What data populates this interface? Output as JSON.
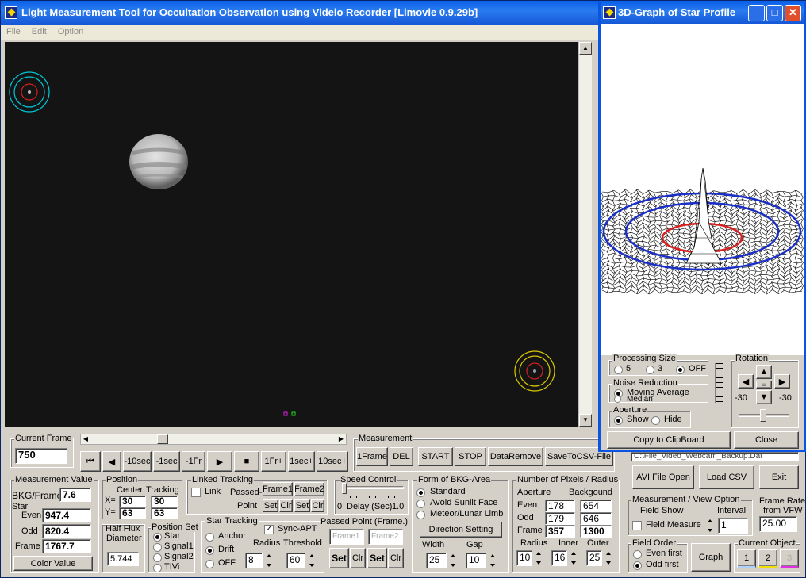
{
  "app": {
    "title": "Light Measurement Tool for Occultation Observation using Videio Recorder [Limovie 0.9.29b]",
    "menu": [
      "File",
      "Edit",
      "Option"
    ]
  },
  "colors": {
    "title_bar": "#0a5fe8",
    "video_bg": "#141414",
    "aperture_cyan": "#00c8d8",
    "aperture_yellow": "#d8c800",
    "aperture_red": "#d82020"
  },
  "current_frame": {
    "label": "Current Frame",
    "value": "750"
  },
  "transport": {
    "first": "⏮",
    "back": "◀",
    "minus10sec": "-10sec",
    "minus1sec": "-1sec",
    "minus1fr": "-1Fr",
    "play": "▶",
    "stop": "■",
    "plus1fr": "1Fr+",
    "plus1sec": "1sec+",
    "plus10sec": "10sec+"
  },
  "measurement": {
    "label": "Measurement",
    "oneframe": "1Frame",
    "del": "DEL",
    "start": "START",
    "stop": "STOP",
    "dataremove": "DataRemove",
    "savecsv": "SaveToCSV-File"
  },
  "file_path": "C:\\File_Video_Webcam_Backup.Dat",
  "measurement_value": {
    "label": "Measurement Value",
    "bkg_label": "BKG/Frame",
    "bkg": "7.6",
    "star_label": "Star",
    "even_label": "Even",
    "even": "947.4",
    "odd_label": "Odd",
    "odd": "820.4",
    "frame_label": "Frame",
    "frame": "1767.7",
    "color_button": "Color Value"
  },
  "position": {
    "label": "Position",
    "center": "Center",
    "tracking": "Tracking",
    "x_label": "X=",
    "y_label": "Y=",
    "cx": "30",
    "cy": "63",
    "tx": "30",
    "ty": "63"
  },
  "half_flux": {
    "label1": "Half Flux",
    "label2": "Diameter",
    "value": "5.744"
  },
  "position_set": {
    "label": "Position Set",
    "options": [
      "Star",
      "Signal1",
      "Signal2",
      "TIVi"
    ],
    "selected": 0
  },
  "linked_tracking": {
    "label": "Linked Tracking",
    "link": "Link",
    "passed1": "Passed-",
    "passed2": "Point",
    "frame1": "Frame1",
    "frame2": "Frame2",
    "set": "Set",
    "clr": "Clr"
  },
  "speed_control": {
    "label": "Speed Control",
    "min": "0",
    "delay": "Delay (Sec)",
    "max": "1.0",
    "level": 0.0
  },
  "star_tracking": {
    "label": "Star Tracking",
    "options": [
      "Anchor",
      "Drift",
      "OFF"
    ],
    "selected": 1,
    "sync": "Sync-APT",
    "radius_label": "Radius",
    "threshold_label": "Threshold",
    "radius": "8",
    "threshold": "60"
  },
  "passed_point": {
    "label": "Passed Point (Frame.)",
    "frame1": "Frame1",
    "frame2": "Frame2",
    "set": "Set",
    "clr": "Clr"
  },
  "bkg_area": {
    "label": "Form of BKG-Area",
    "options": [
      "Standard",
      "Avoid Sunlit Face",
      "Meteor/Lunar Limb"
    ],
    "selected": 0,
    "direction": "Direction Setting",
    "width_label": "Width",
    "gap_label": "Gap",
    "width": "25",
    "gap": "10"
  },
  "pixels": {
    "label": "Number of Pixels / Radius",
    "aperture": "Aperture",
    "background": "Backgound",
    "even_label": "Even",
    "odd_label": "Odd",
    "frame_label": "Frame",
    "ap_even": "178",
    "bg_even": "654",
    "ap_odd": "179",
    "bg_odd": "646",
    "ap_frame": "357",
    "bg_frame": "1300",
    "radius_label": "Radius",
    "inner_label": "Inner",
    "outer_label": "Outer",
    "radius": "10",
    "inner": "16",
    "outer": "25"
  },
  "file_buttons": {
    "avi": "AVI File Open",
    "csv": "Load CSV",
    "exit": "Exit"
  },
  "view_option": {
    "label": "Measurement / View Option",
    "field_show": "Field Show",
    "interval_label": "Interval",
    "interval": "1",
    "field_measure": "Field Measure"
  },
  "frame_rate": {
    "label1": "Frame Rate",
    "label2": "from VFW",
    "value": "25.00"
  },
  "field_order": {
    "label": "Field Order",
    "options": [
      "Even first",
      "Odd first"
    ],
    "selected": 1
  },
  "graph_button": "Graph",
  "current_object": {
    "label": "Current Object",
    "options": [
      "1",
      "2",
      "3"
    ]
  },
  "profile_window": {
    "title": "3D-Graph of Star Profile",
    "processing": {
      "label": "Processing Size",
      "options": [
        "5",
        "3",
        "OFF"
      ],
      "selected": 2
    },
    "noise": {
      "label": "Noise Reduction",
      "options": [
        "Moving Average",
        "Median"
      ],
      "selected": 0
    },
    "aperture": {
      "label": "Aperture",
      "options": [
        "Show",
        "Hide"
      ],
      "selected": 0
    },
    "rotation": {
      "label": "Rotation",
      "left_value": "-30",
      "right_value": "-30"
    },
    "copy": "Copy to ClipBoard",
    "close": "Close"
  }
}
